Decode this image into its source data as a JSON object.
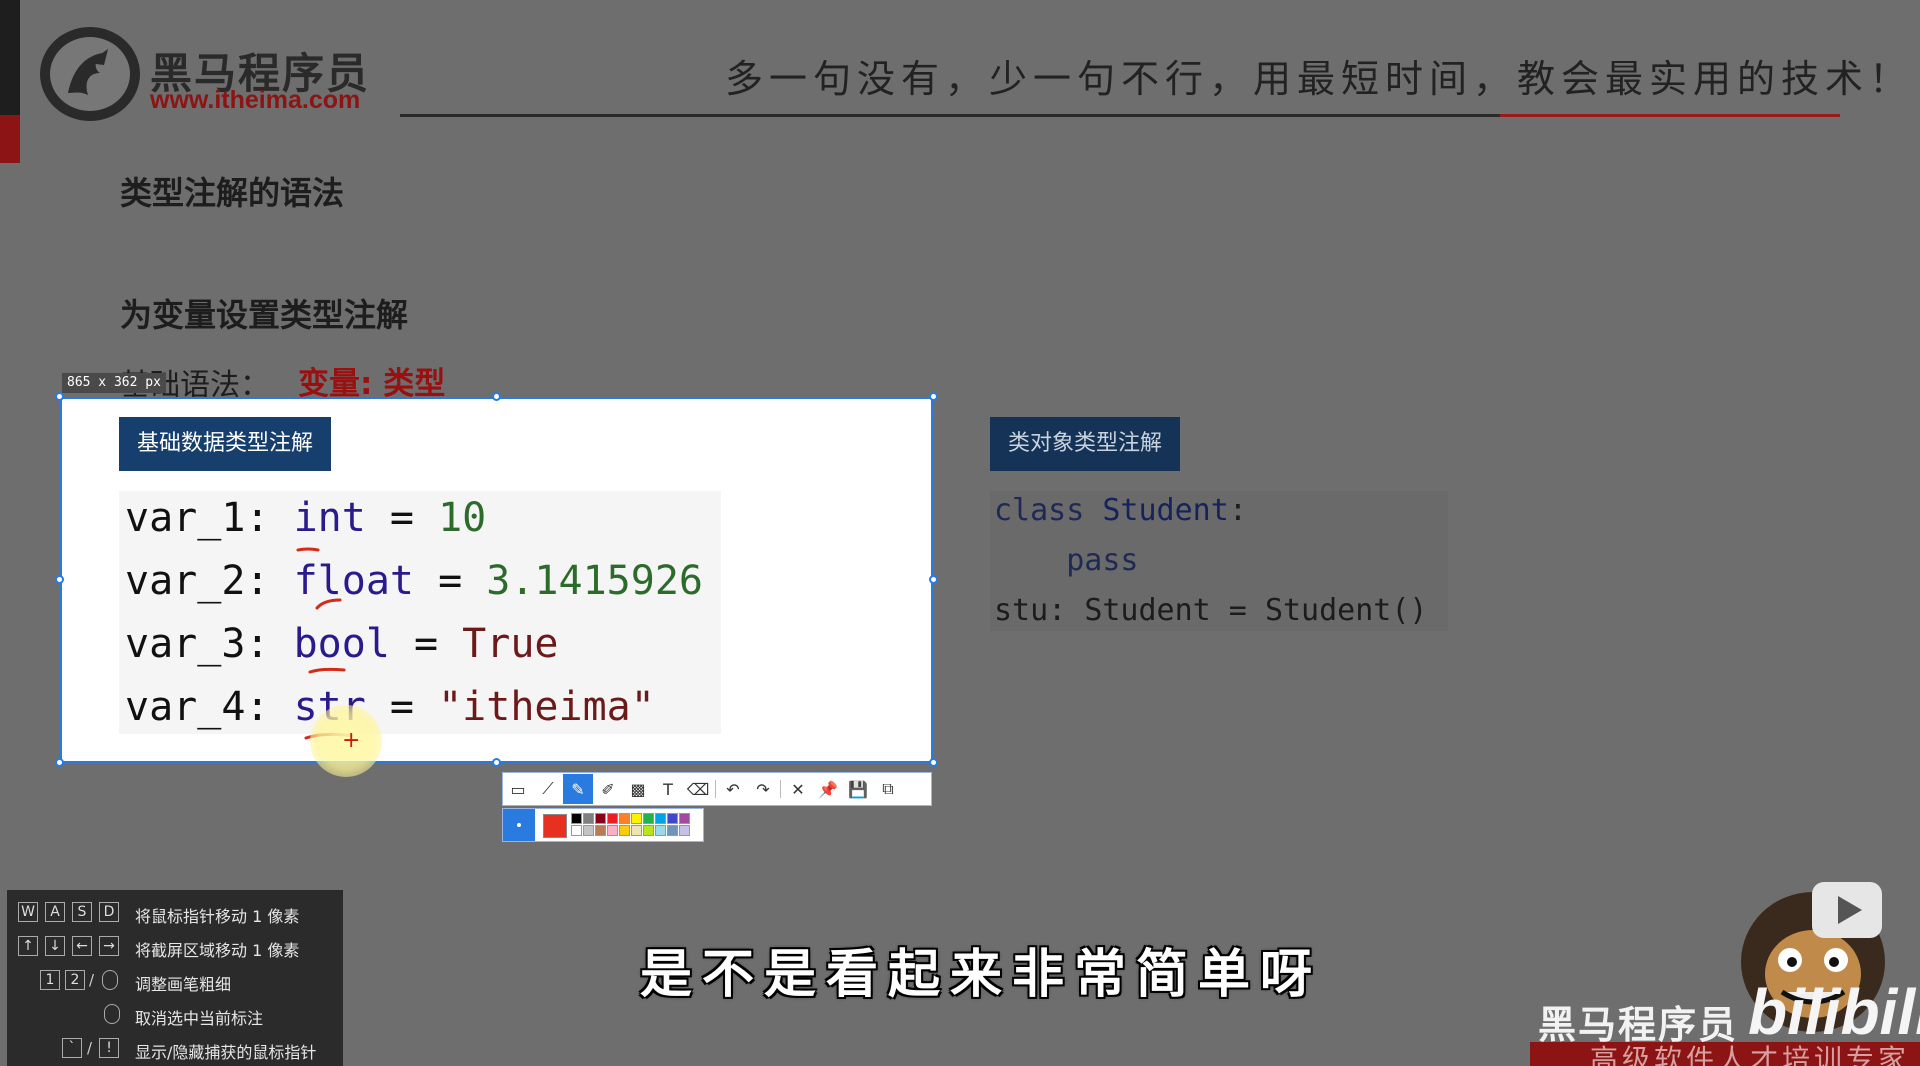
{
  "header": {
    "logo_cn": "黑马程序员",
    "logo_url": "www.itheima.com",
    "slogan": "多一句没有，少一句不行，用最短时间，教会最实用的技术！"
  },
  "slide": {
    "title": "类型注解的语法",
    "subtitle": "为变量设置类型注解",
    "syntax_label": "基础语法：",
    "syntax_value": "变量: 类型",
    "basic_tag": "基础数据类型注解",
    "class_tag": "类对象类型注解",
    "basic_code": [
      {
        "var": "var_1: ",
        "type": "int",
        "eq": " = ",
        "val": "10"
      },
      {
        "var": "var_2: ",
        "type": "float",
        "eq": " = ",
        "val": "3.1415926"
      },
      {
        "var": "var_3: ",
        "type": "bool",
        "eq": " = ",
        "val": "True"
      },
      {
        "var": "var_4: ",
        "type": "str",
        "eq": " = ",
        "val": "\"itheima\""
      }
    ],
    "class_code": {
      "l1_kw": "class ",
      "l1_name": "Student",
      "l1_end": ":",
      "l2": "    pass",
      "l3_a": "stu: ",
      "l3_b": "Student",
      "l3_c": " = ",
      "l3_d": "Student()"
    }
  },
  "capture": {
    "size_label": "865 x 362  px"
  },
  "toolbar": {
    "icons": [
      "rect-icon",
      "polyline-icon",
      "pen-icon",
      "marker-icon",
      "mosaic-icon",
      "text-icon",
      "eraser-icon",
      "undo-icon",
      "redo-icon",
      "close-icon",
      "pin-icon",
      "save-icon",
      "copy-icon"
    ],
    "active": "pen-icon",
    "current_color": "#e83020"
  },
  "palette": {
    "row1": [
      "#000000",
      "#7f7f7f",
      "#880015",
      "#ed1c24",
      "#ff7f27",
      "#fff200",
      "#22b14c",
      "#00a2e8",
      "#3f48cc",
      "#a349a4"
    ],
    "row2": [
      "#ffffff",
      "#c3c3c3",
      "#b97a57",
      "#ffaec9",
      "#ffc90e",
      "#efe4b0",
      "#b5e61d",
      "#99d9ea",
      "#7092be",
      "#c8bfe7"
    ]
  },
  "shortcuts": [
    {
      "keys": [
        "W",
        "A",
        "S",
        "D"
      ],
      "text": "将鼠标指针移动 1 像素"
    },
    {
      "keys": [
        "↑",
        "↓",
        "←",
        "→"
      ],
      "text": "将截屏区域移动 1 像素"
    },
    {
      "keys": [
        "1",
        "2"
      ],
      "mouse": true,
      "text": "调整画笔粗细"
    },
    {
      "keys": [],
      "mouse": true,
      "text": "取消选中当前标注"
    },
    {
      "keys": [
        "`",
        "!"
      ],
      "text": "显示/隐藏捕获的鼠标指针"
    }
  ],
  "video": {
    "subtitle": "是不是看起来非常简单呀",
    "brand_cn": "黑马程序员",
    "brand_bili": "bilibili",
    "band_text": "高级软件人才培训专家"
  }
}
